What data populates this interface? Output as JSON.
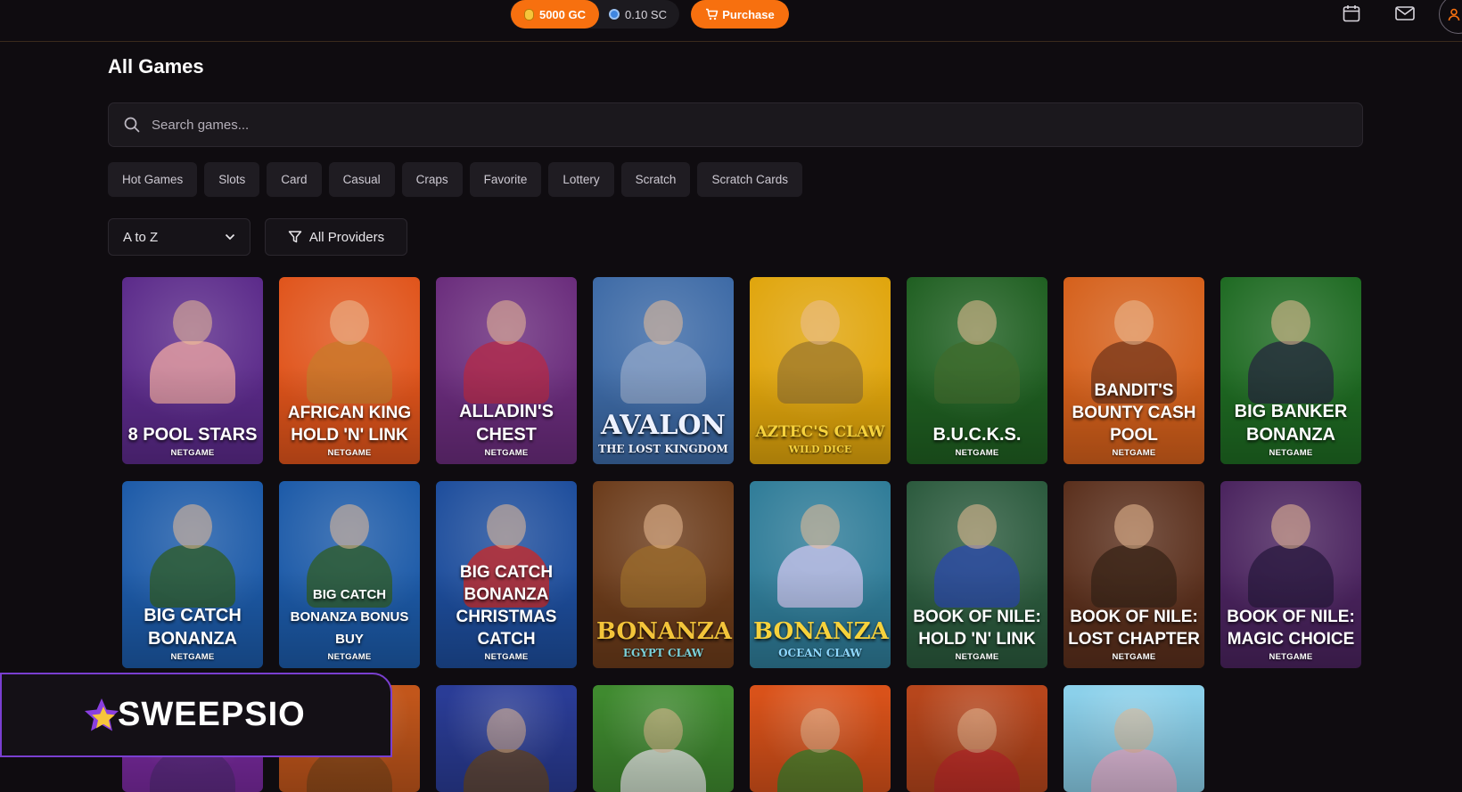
{
  "header": {
    "gc_balance": "5000 GC",
    "sc_balance": "0.10 SC",
    "purchase_label": "Purchase"
  },
  "page_title": "All Games",
  "search": {
    "placeholder": "Search games..."
  },
  "categories": [
    "Hot Games",
    "Slots",
    "Card",
    "Casual",
    "Craps",
    "Favorite",
    "Lottery",
    "Scratch",
    "Scratch Cards"
  ],
  "filters": {
    "sort_label": "A to Z",
    "providers_label": "All Providers"
  },
  "games": [
    {
      "title": "8 Pool Stars",
      "provider": "NETGAME",
      "bg": "#5b2a8a"
    },
    {
      "title": "African King Hold 'N' Link",
      "provider": "NETGAME",
      "bg": "#e0541b"
    },
    {
      "title": "Alladin's Chest",
      "provider": "NETGAME",
      "bg": "#6a2c7c"
    },
    {
      "title": "",
      "provider": "",
      "bg": "#3d6aa6"
    },
    {
      "title": "",
      "provider": "",
      "bg": "#e0a50c"
    },
    {
      "title": "B.U.C.K.S.",
      "provider": "NETGAME",
      "bg": "#1f5f21"
    },
    {
      "title": "Bandit's Bounty Cash Pool",
      "provider": "NETGAME",
      "bg": "#d5601b"
    },
    {
      "title": "Big Banker Bonanza",
      "provider": "NETGAME",
      "bg": "#1e6a22"
    },
    {
      "title": "Big Catch Bonanza",
      "provider": "NETGAME",
      "bg": "#1c5aa8"
    },
    {
      "title": "Big Catch Bonanza Bonus Buy",
      "provider": "NETGAME",
      "bg": "#1c5aa8"
    },
    {
      "title": "Big Catch Bonanza Christmas Catch",
      "provider": "NETGAME",
      "bg": "#1d4d9c"
    },
    {
      "title": "",
      "provider": "",
      "bg": "#6b3b1a"
    },
    {
      "title": "",
      "provider": "",
      "bg": "#2f7c98"
    },
    {
      "title": "Book of Nile: Hold 'N' Link",
      "provider": "NETGAME",
      "bg": "#2b5a3d"
    },
    {
      "title": "Book of Nile: Lost Chapter",
      "provider": "NETGAME",
      "bg": "#5a2f1c"
    },
    {
      "title": "Book of Nile: Magic Choice",
      "provider": "NETGAME",
      "bg": "#4a235e"
    },
    {
      "title": "",
      "provider": "",
      "bg": "#7a2aa0"
    },
    {
      "title": "",
      "provider": "",
      "bg": "#c2561b"
    },
    {
      "title": "",
      "provider": "",
      "bg": "#2a3c96"
    },
    {
      "title": "",
      "provider": "",
      "bg": "#3f8a2f"
    },
    {
      "title": "",
      "provider": "",
      "bg": "#d9521a"
    },
    {
      "title": "",
      "provider": "",
      "bg": "#b7461c"
    },
    {
      "title": "",
      "provider": "",
      "bg": "#8bd0ea"
    }
  ],
  "logos": [
    {
      "main": "Avalon",
      "sub": "The Lost Kingdom"
    },
    {
      "main": "Aztec's Claw",
      "sub": "Wild Dice"
    },
    {
      "main": "Bonanza",
      "sub": "Egypt Claw"
    },
    {
      "main": "Bonanza",
      "sub": "Ocean Claw"
    }
  ],
  "brand": {
    "name": "SWEEPSIO"
  },
  "colors": {
    "accent": "#f7700f",
    "brand_purple": "#7a3fd0",
    "background": "#0f0c10"
  }
}
